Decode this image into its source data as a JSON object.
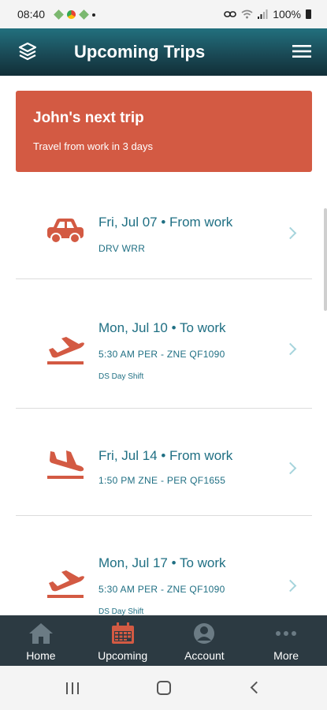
{
  "status_bar": {
    "time": "08:40",
    "battery": "100%"
  },
  "header": {
    "title": "Upcoming Trips",
    "left_icon": "layers-icon",
    "right_icon": "menu-icon"
  },
  "next_trip": {
    "title": "John's next trip",
    "subtitle": "Travel from work in 3 days"
  },
  "trips": [
    {
      "icon": "car-icon",
      "date": "Fri, Jul 07 • From work",
      "detail": "DRV WRR"
    },
    {
      "icon": "plane-takeoff-icon",
      "date": "Mon, Jul 10 • To work",
      "detail": "5:30 AM PER - ZNE QF1090",
      "shift": "DS Day Shift"
    },
    {
      "icon": "plane-landing-icon",
      "date": "Fri, Jul 14 • From work",
      "detail": "1:50 PM ZNE - PER QF1655"
    },
    {
      "icon": "plane-takeoff-icon",
      "date": "Mon, Jul 17 • To work",
      "detail": "5:30 AM PER - ZNE QF1090",
      "shift": "DS Day Shift"
    }
  ],
  "bottom_nav": [
    {
      "label": "Home",
      "icon": "home-icon"
    },
    {
      "label": "Upcoming",
      "icon": "calendar-icon",
      "active": true
    },
    {
      "label": "Account",
      "icon": "account-icon"
    },
    {
      "label": "More",
      "icon": "more-icon"
    }
  ],
  "colors": {
    "header": "#1a4a56",
    "accent": "#d35a43",
    "trip_text": "#1f6f83",
    "nav_bg": "#2c3a42",
    "nav_inactive": "#6b7b84"
  }
}
